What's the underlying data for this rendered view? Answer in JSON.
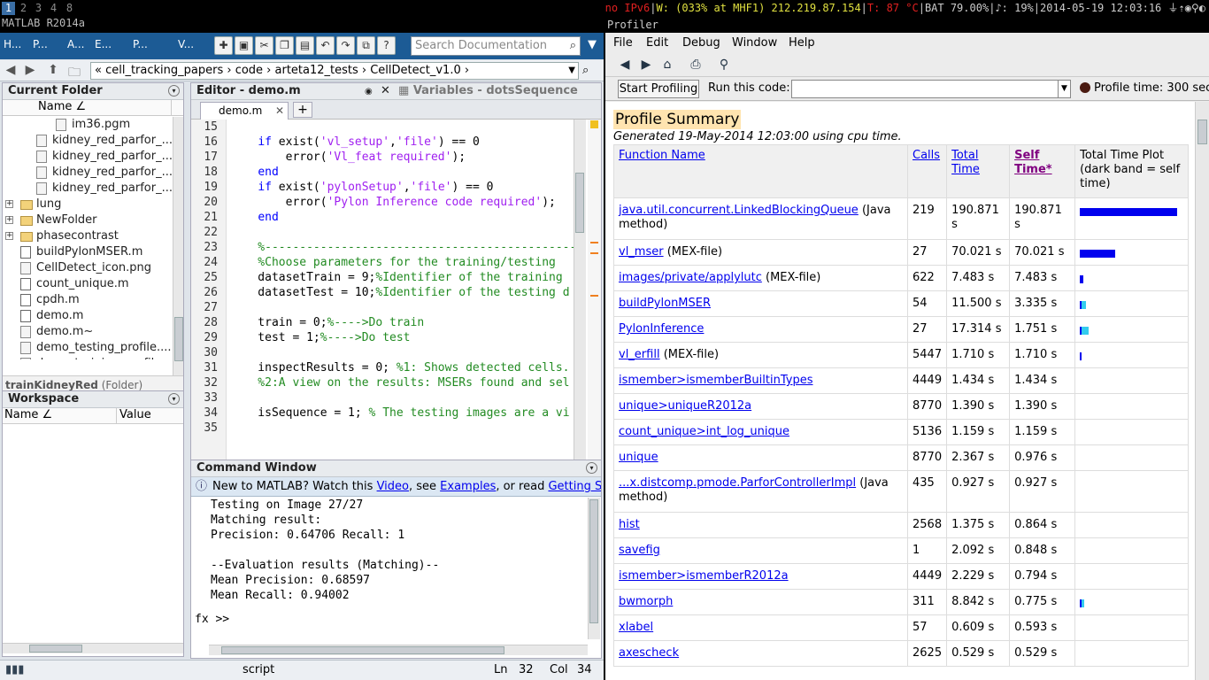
{
  "topbar": {
    "workspaces": [
      "1",
      "2",
      "3",
      "4",
      "8"
    ],
    "window_title": "MATLAB R2014a",
    "status": {
      "ipv6": "no IPv6",
      "wifi": "W: (033% at MHF1) 212.219.87.154",
      "temp": "T: 87 °C",
      "battery": "BAT 79.00%",
      "volume": "♪: 19%",
      "datetime": "2014-05-19 12:03:16"
    }
  },
  "matlab": {
    "ribbon_tabs": [
      "H...",
      "P...",
      "A...",
      "E...",
      "P...",
      "V..."
    ],
    "search_placeholder": "Search Documentation",
    "path": "« cell_tracking_papers › code › arteta12_tests › CellDetect_v1.0 ›",
    "current_folder": {
      "title": "Current Folder",
      "col_name": "Name ∠",
      "items": [
        {
          "name": "im36.pgm",
          "type": "file"
        },
        {
          "name": "kidney_red_parfor_...",
          "type": "grid"
        },
        {
          "name": "kidney_red_parfor_...",
          "type": "grid"
        },
        {
          "name": "kidney_red_parfor_...",
          "type": "grid"
        },
        {
          "name": "kidney_red_parfor_...",
          "type": "grid"
        },
        {
          "name": "lung",
          "type": "folder"
        },
        {
          "name": "NewFolder",
          "type": "folder"
        },
        {
          "name": "phasecontrast",
          "type": "folder"
        },
        {
          "name": "buildPylonMSER.m",
          "type": "m"
        },
        {
          "name": "CellDetect_icon.png",
          "type": "img"
        },
        {
          "name": "count_unique.m",
          "type": "m"
        },
        {
          "name": "cpdh.m",
          "type": "m"
        },
        {
          "name": "demo.m",
          "type": "m"
        },
        {
          "name": "demo.m~",
          "type": "file"
        },
        {
          "name": "demo_testing_profile....",
          "type": "file"
        },
        {
          "name": "demo_training_profile...",
          "type": "file"
        }
      ],
      "details_name": "trainKidneyRed",
      "details_type": "(Folder)"
    },
    "workspace": {
      "title": "Workspace",
      "col_name": "Name ∠",
      "col_value": "Value"
    },
    "editor": {
      "title": "Editor - demo.m",
      "variables_title": "Variables - dotsSequence",
      "tab": "demo.m",
      "lines": [
        {
          "n": "15",
          "segs": []
        },
        {
          "n": "16",
          "segs": [
            {
              "t": "    ",
              "c": ""
            },
            {
              "t": "if",
              "c": "kw"
            },
            {
              "t": " exist(",
              "c": ""
            },
            {
              "t": "'vl_setup'",
              "c": "str"
            },
            {
              "t": ",",
              "c": ""
            },
            {
              "t": "'file'",
              "c": "str"
            },
            {
              "t": ") == 0",
              "c": ""
            }
          ]
        },
        {
          "n": "17",
          "segs": [
            {
              "t": "        error(",
              "c": ""
            },
            {
              "t": "'Vl_feat required'",
              "c": "str"
            },
            {
              "t": ");",
              "c": ""
            }
          ]
        },
        {
          "n": "18",
          "segs": [
            {
              "t": "    ",
              "c": ""
            },
            {
              "t": "end",
              "c": "kw"
            }
          ]
        },
        {
          "n": "19",
          "segs": [
            {
              "t": "    ",
              "c": ""
            },
            {
              "t": "if",
              "c": "kw"
            },
            {
              "t": " exist(",
              "c": ""
            },
            {
              "t": "'pylonSetup'",
              "c": "str"
            },
            {
              "t": ",",
              "c": ""
            },
            {
              "t": "'file'",
              "c": "str"
            },
            {
              "t": ") == 0",
              "c": ""
            }
          ]
        },
        {
          "n": "20",
          "segs": [
            {
              "t": "        error(",
              "c": ""
            },
            {
              "t": "'Pylon Inference code required'",
              "c": "str"
            },
            {
              "t": ");",
              "c": ""
            }
          ]
        },
        {
          "n": "21",
          "segs": [
            {
              "t": "    ",
              "c": ""
            },
            {
              "t": "end",
              "c": "kw"
            }
          ]
        },
        {
          "n": "22",
          "segs": []
        },
        {
          "n": "23",
          "segs": [
            {
              "t": "    %-----------------------------------------------",
              "c": "cm"
            }
          ]
        },
        {
          "n": "24",
          "segs": [
            {
              "t": "    %Choose parameters for the training/testing",
              "c": "cm"
            }
          ]
        },
        {
          "n": "25",
          "segs": [
            {
              "t": "    datasetTrain = 9;",
              "c": ""
            },
            {
              "t": "%Identifier of the training",
              "c": "cm"
            }
          ]
        },
        {
          "n": "26",
          "segs": [
            {
              "t": "    datasetTest = 10;",
              "c": ""
            },
            {
              "t": "%Identifier of the testing d",
              "c": "cm"
            }
          ]
        },
        {
          "n": "27",
          "segs": []
        },
        {
          "n": "28",
          "segs": [
            {
              "t": "    train = 0;",
              "c": ""
            },
            {
              "t": "%---->Do train",
              "c": "cm"
            }
          ]
        },
        {
          "n": "29",
          "segs": [
            {
              "t": "    test = 1;",
              "c": ""
            },
            {
              "t": "%---->Do test",
              "c": "cm"
            }
          ]
        },
        {
          "n": "30",
          "segs": []
        },
        {
          "n": "31",
          "segs": [
            {
              "t": "    inspectResults = 0; ",
              "c": ""
            },
            {
              "t": "%1: Shows detected cells.",
              "c": "cm"
            }
          ]
        },
        {
          "n": "32",
          "segs": [
            {
              "t": "    %2:A view on the results: MSERs found and sel",
              "c": "cm"
            }
          ]
        },
        {
          "n": "33",
          "segs": []
        },
        {
          "n": "34",
          "segs": [
            {
              "t": "    isSequence = 1; ",
              "c": ""
            },
            {
              "t": "% The testing images are a vi",
              "c": "cm"
            }
          ]
        },
        {
          "n": "35",
          "segs": []
        }
      ]
    },
    "command_window": {
      "title": "Command Window",
      "info_prefix": "New to MATLAB? Watch this ",
      "info_link1": "Video",
      "info_mid1": ", see ",
      "info_link2": "Examples",
      "info_mid2": ", or read ",
      "info_link3": "Getting Star",
      "lines": [
        "Testing on Image 27/27",
        "Matching result:",
        "Precision: 0.64706 Recall: 1",
        "",
        "--Evaluation results (Matching)--",
        "Mean Precision: 0.68597",
        "Mean Recall: 0.94002"
      ],
      "prompt": "fx  >>"
    },
    "statusbar": {
      "mode": "script",
      "ln_label": "Ln",
      "ln": "32",
      "col_label": "Col",
      "col": "34"
    }
  },
  "profiler": {
    "title": "Profiler",
    "menu": [
      "File",
      "Edit",
      "Debug",
      "Window",
      "Help"
    ],
    "start_button": "Start Profiling",
    "run_label": "Run this code:",
    "profile_time": "Profile time: 300 sec",
    "heading": "Profile Summary",
    "generated": "Generated 19-May-2014 12:03:00 using cpu time.",
    "columns": {
      "function": "Function Name",
      "calls": "Calls",
      "total": "Total Time",
      "self": "Self Time*",
      "plot": "Total Time Plot (dark band = self time)"
    },
    "rows": [
      {
        "fn": "java.util.concurrent.LinkedBlockingQueue",
        "note": " (Java method)",
        "calls": "219",
        "total": "190.871 s",
        "self": "190.871 s",
        "tbar": 0.9,
        "sbar": 0.9,
        "tall": true
      },
      {
        "fn": "vl_mser",
        "note": " (MEX-file)",
        "calls": "27",
        "total": "70.021 s",
        "self": "70.021 s",
        "tbar": 0.33,
        "sbar": 0.33,
        "tall": false
      },
      {
        "fn": "images/private/applylutc",
        "note": " (MEX-file)",
        "calls": "622",
        "total": "7.483 s",
        "self": "7.483 s",
        "tbar": 0.035,
        "sbar": 0.035,
        "tall": false
      },
      {
        "fn": "buildPylonMSER",
        "note": "",
        "calls": "54",
        "total": "11.500 s",
        "self": "3.335 s",
        "tbar": 0.054,
        "sbar": 0.016,
        "tall": false
      },
      {
        "fn": "PylonInference",
        "note": "",
        "calls": "27",
        "total": "17.314 s",
        "self": "1.751 s",
        "tbar": 0.081,
        "sbar": 0.008,
        "tall": false
      },
      {
        "fn": "vl_erfill",
        "note": " (MEX-file)",
        "calls": "5447",
        "total": "1.710 s",
        "self": "1.710 s",
        "tbar": 0.008,
        "sbar": 0.008,
        "tall": false
      },
      {
        "fn": "ismember>ismemberBuiltinTypes",
        "note": "",
        "calls": "4449",
        "total": "1.434 s",
        "self": "1.434 s",
        "tbar": 0,
        "sbar": 0,
        "tall": false
      },
      {
        "fn": "unique>uniqueR2012a",
        "note": "",
        "calls": "8770",
        "total": "1.390 s",
        "self": "1.390 s",
        "tbar": 0,
        "sbar": 0,
        "tall": false
      },
      {
        "fn": "count_unique>int_log_unique",
        "note": "",
        "calls": "5136",
        "total": "1.159 s",
        "self": "1.159 s",
        "tbar": 0,
        "sbar": 0,
        "tall": false
      },
      {
        "fn": "unique",
        "note": "",
        "calls": "8770",
        "total": "2.367 s",
        "self": "0.976 s",
        "tbar": 0,
        "sbar": 0,
        "tall": false
      },
      {
        "fn": "...x.distcomp.pmode.ParforControllerImpl",
        "note": " (Java method)",
        "calls": "435",
        "total": "0.927 s",
        "self": "0.927 s",
        "tbar": 0,
        "sbar": 0,
        "tall": true
      },
      {
        "fn": "hist",
        "note": "",
        "calls": "2568",
        "total": "1.375 s",
        "self": "0.864 s",
        "tbar": 0,
        "sbar": 0,
        "tall": false
      },
      {
        "fn": "savefig",
        "note": "",
        "calls": "1",
        "total": "2.092 s",
        "self": "0.848 s",
        "tbar": 0,
        "sbar": 0,
        "tall": false
      },
      {
        "fn": "ismember>ismemberR2012a",
        "note": "",
        "calls": "4449",
        "total": "2.229 s",
        "self": "0.794 s",
        "tbar": 0,
        "sbar": 0,
        "tall": false
      },
      {
        "fn": "bwmorph",
        "note": "",
        "calls": "311",
        "total": "8.842 s",
        "self": "0.775 s",
        "tbar": 0.04,
        "sbar": 0.004,
        "tall": false
      },
      {
        "fn": "xlabel",
        "note": "",
        "calls": "57",
        "total": "0.609 s",
        "self": "0.593 s",
        "tbar": 0,
        "sbar": 0,
        "tall": false
      },
      {
        "fn": "axescheck",
        "note": "",
        "calls": "2625",
        "total": "0.529 s",
        "self": "0.529 s",
        "tbar": 0,
        "sbar": 0,
        "tall": false
      }
    ],
    "colors": {
      "bar_self": "#0000ee",
      "bar_total": "#33ccee",
      "heading_bg": "#ffe4b0"
    }
  }
}
